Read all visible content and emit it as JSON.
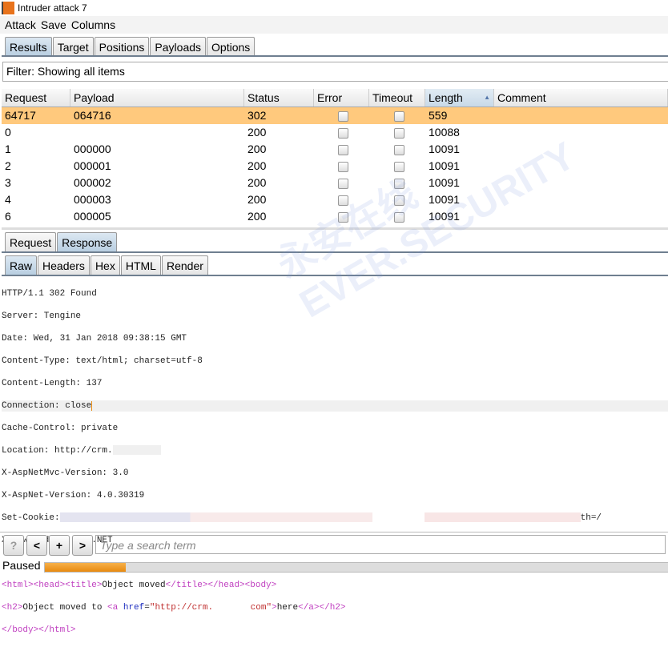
{
  "window": {
    "title": "Intruder attack 7"
  },
  "menu": [
    "Attack",
    "Save",
    "Columns"
  ],
  "tabs": [
    "Results",
    "Target",
    "Positions",
    "Payloads",
    "Options"
  ],
  "filter": "Filter: Showing all items",
  "table": {
    "columns": [
      "Request",
      "Payload",
      "Status",
      "Error",
      "Timeout",
      "Length",
      "Comment"
    ],
    "sorted_column": "Length",
    "rows": [
      {
        "request": "64717",
        "payload": "064716",
        "status": "302",
        "error": false,
        "timeout": false,
        "length": "559",
        "selected": true
      },
      {
        "request": "0",
        "payload": "",
        "status": "200",
        "error": false,
        "timeout": false,
        "length": "10088"
      },
      {
        "request": "1",
        "payload": "000000",
        "status": "200",
        "error": false,
        "timeout": false,
        "length": "10091"
      },
      {
        "request": "2",
        "payload": "000001",
        "status": "200",
        "error": false,
        "timeout": false,
        "length": "10091"
      },
      {
        "request": "3",
        "payload": "000002",
        "status": "200",
        "error": false,
        "timeout": false,
        "length": "10091"
      },
      {
        "request": "4",
        "payload": "000003",
        "status": "200",
        "error": false,
        "timeout": false,
        "length": "10091"
      },
      {
        "request": "6",
        "payload": "000005",
        "status": "200",
        "error": false,
        "timeout": false,
        "length": "10091"
      }
    ]
  },
  "reqres_tabs": [
    "Request",
    "Response"
  ],
  "view_tabs": [
    "Raw",
    "Headers",
    "Hex",
    "HTML",
    "Render"
  ],
  "response": {
    "lines": [
      "HTTP/1.1 302 Found",
      "Server: Tengine",
      "Date: Wed, 31 Jan 2018 09:38:15 GMT",
      "Content-Type: text/html; charset=utf-8",
      "Content-Length: 137",
      "Connection: close",
      "Cache-Control: private",
      "Location: http://crm.",
      "X-AspNetMvc-Version: 3.0",
      "X-AspNet-Version: 4.0.30319",
      "Set-Cookie:",
      "X-Powered-By: ASP.NET"
    ],
    "cookie_tail": "th=/",
    "body1": {
      "t1": "<html><head><title>",
      "text": "Object moved",
      "t2": "</title></head><body>"
    },
    "body2": {
      "t1": "<h2>",
      "text": "Object moved to ",
      "t2": "<a ",
      "attr": "href",
      "eq": "=",
      "val": "\"http://crm.",
      "val2": " com\"",
      "t3": ">",
      "here": "here",
      "t4": "</a>",
      ".": ".",
      "t5": "</h2>"
    },
    "body3": "</body></html>"
  },
  "bottom": {
    "help": "?",
    "prev": "<",
    "add": "+",
    "next": ">",
    "search_placeholder": "Type a search term"
  },
  "status": {
    "text": "Paused",
    "progress": 0.13
  },
  "watermark": "永安在线 EVER.SECURITY",
  "colors": {
    "selected_row": "#ffc97d",
    "progress": "#e88a10"
  }
}
